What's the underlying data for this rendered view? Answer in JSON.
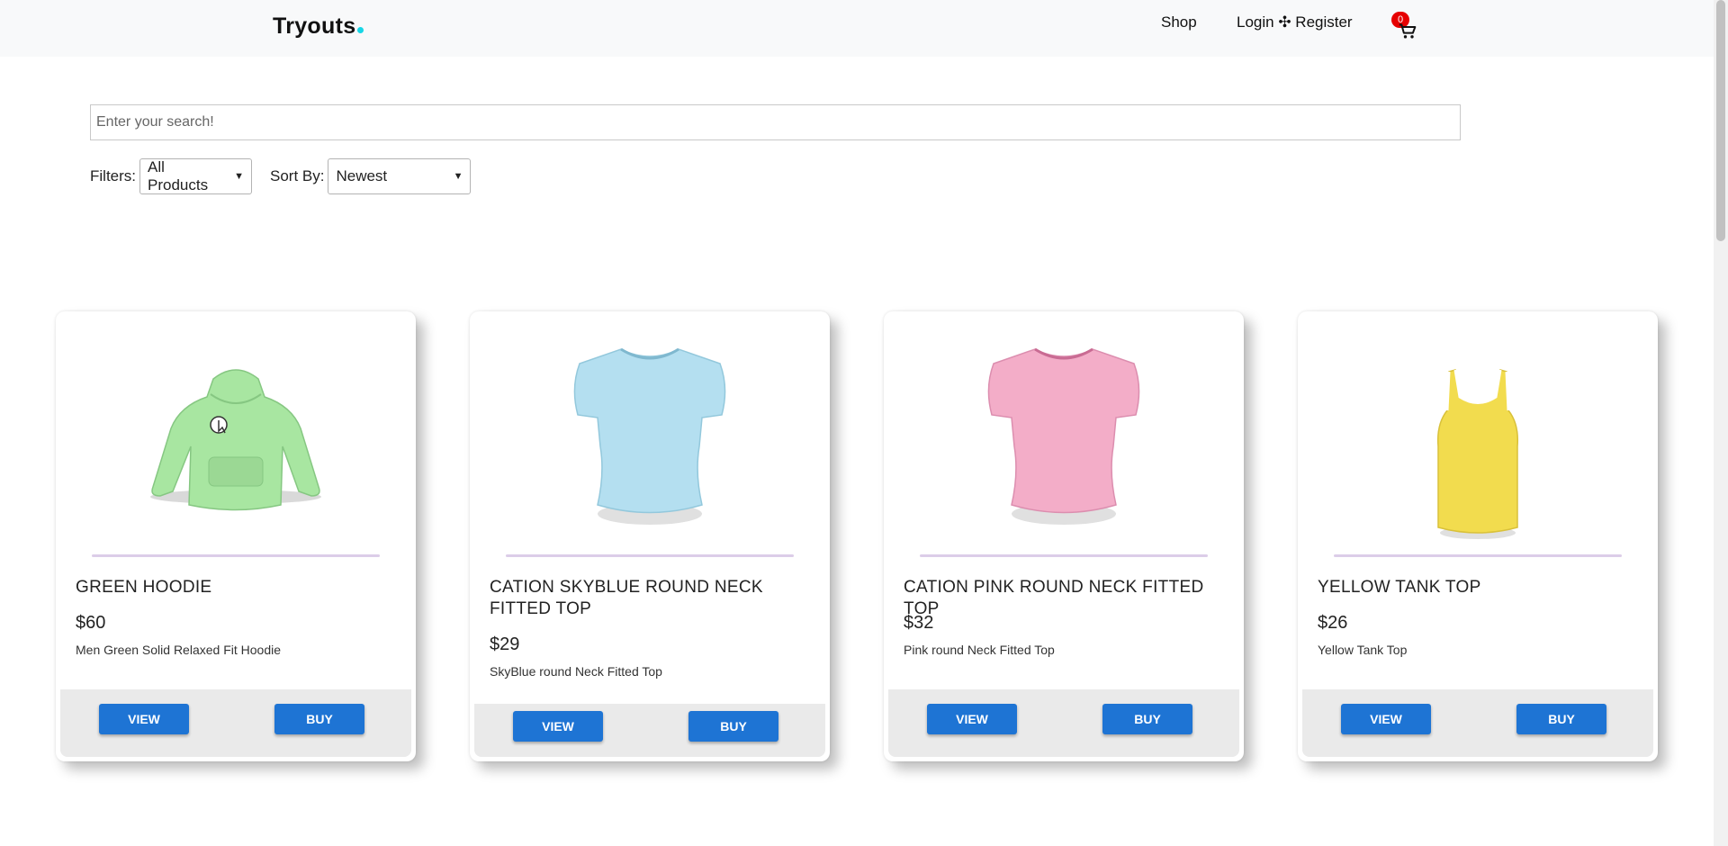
{
  "nav": {
    "brand": "Tryouts",
    "shop": "Shop",
    "login_register": "Login ✣ Register",
    "cart_count": "0",
    "colors": {
      "accent_dot": "#17d6e6",
      "badge": "#e60000"
    }
  },
  "search": {
    "placeholder": "Enter your search!"
  },
  "filters": {
    "filters_label": "Filters:",
    "filters_value": "All Products",
    "sort_label": "Sort By:",
    "sort_value": "Newest"
  },
  "products": [
    {
      "title": "GREEN HOODIE",
      "price": "$60",
      "description": "Men Green Solid Relaxed Fit Hoodie",
      "view": "VIEW",
      "buy": "BUY",
      "color": "#a8e6a1"
    },
    {
      "title": "CATION SKYBLUE ROUND NECK FITTED TOP",
      "price": "$29",
      "description": "SkyBlue round Neck Fitted Top",
      "view": "VIEW",
      "buy": "BUY",
      "color": "#b4dff0"
    },
    {
      "title": "CATION PINK ROUND NECK FITTED TOP",
      "price": "$32",
      "description": "Pink round Neck Fitted Top",
      "view": "VIEW",
      "buy": "BUY",
      "color": "#f3adc8"
    },
    {
      "title": "YELLOW TANK TOP",
      "price": "$26",
      "description": "Yellow Tank Top",
      "view": "VIEW",
      "buy": "BUY",
      "color": "#f2dc4e"
    }
  ],
  "button_color": "#1e74d4"
}
